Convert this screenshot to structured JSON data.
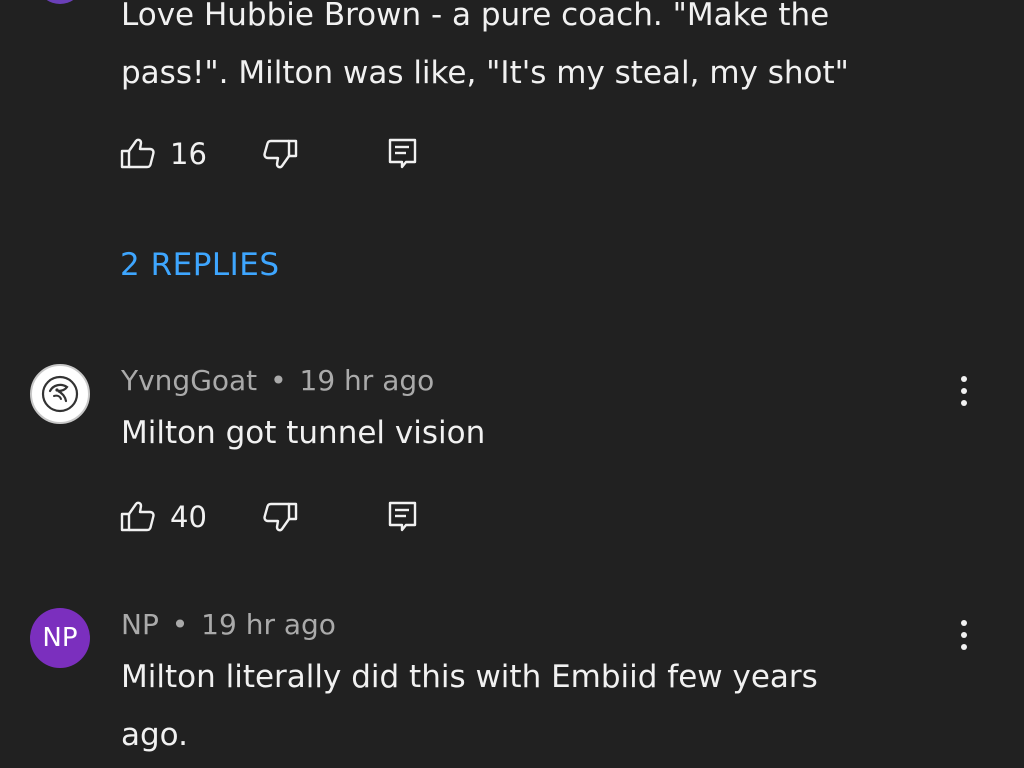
{
  "thread": {
    "top_comment": {
      "line1": "Love Hubbie Brown - a pure coach.  \"Make the",
      "line2": "pass!\".  Milton was like, \"It's my steal, my shot\"",
      "like_count": "16",
      "replies_label": "2 REPLIES"
    },
    "comments": [
      {
        "author": "YvngGoat",
        "separator": "•",
        "time": "19 hr ago",
        "text": "Milton got tunnel vision",
        "like_count": "40",
        "avatar": "goat-icon"
      },
      {
        "author": "NP",
        "separator": "•",
        "time": "19 hr ago",
        "line1": "Milton literally did this with Embiid few years",
        "line2": "ago.",
        "avatar_initials": "NP"
      }
    ]
  },
  "colors": {
    "background": "#212121",
    "link": "#3ea6ff",
    "secondary_text": "#aaaaaa",
    "avatar_np": "#7b2fbe"
  },
  "icons": {
    "like": "thumbs-up-icon",
    "dislike": "thumbs-down-icon",
    "reply": "reply-comment-icon",
    "more": "more-vertical-icon"
  }
}
